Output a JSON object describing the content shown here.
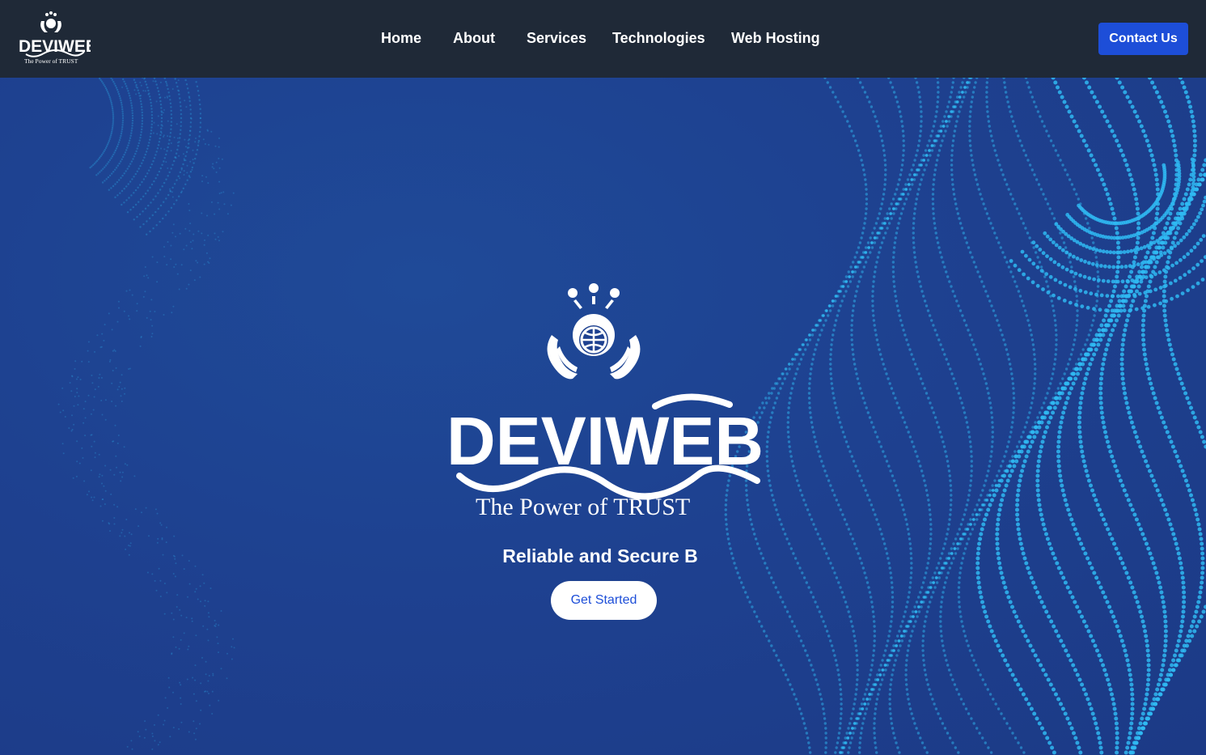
{
  "brand": {
    "logo_text": "DEVIWEB",
    "logo_tagline": "The Power of TRUST"
  },
  "nav": {
    "items": [
      {
        "label": "Home"
      },
      {
        "label": "About"
      },
      {
        "label": "Services"
      },
      {
        "label": "Technologies"
      },
      {
        "label": "Web Hosting"
      }
    ],
    "contact_label": "Contact Us"
  },
  "hero": {
    "logo_text": "DEVIWEB",
    "logo_tagline": "The Power of TRUST",
    "subtitle": "Reliable and Secure B",
    "cta_label": "Get Started"
  },
  "colors": {
    "navbar_bg": "#1f2937",
    "hero_bg": "#1e4190",
    "accent": "#1d4ed8",
    "dots": "#2fb8f2"
  },
  "icons": [
    "hands-globe-gear-icon"
  ]
}
